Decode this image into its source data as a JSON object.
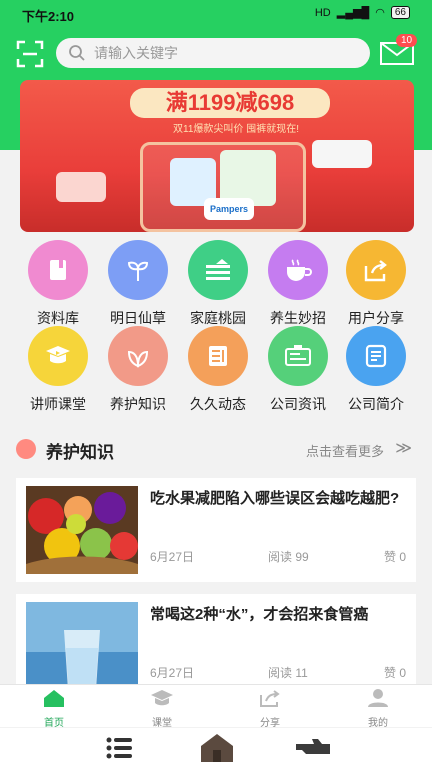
{
  "status": {
    "time": "下午2:10",
    "network": "HD",
    "battery": "66"
  },
  "search": {
    "placeholder": "请输入关键字"
  },
  "mail": {
    "badge": "10"
  },
  "banner": {
    "headline": "满1199减698",
    "subline": "双11爆款尖叫价 囤裤就现在!",
    "brand": "Pampers"
  },
  "grid": [
    {
      "label": "资料库",
      "color": "#f08ad0",
      "icon": "book-icon"
    },
    {
      "label": "明日仙草",
      "color": "#7d9ef5",
      "icon": "sprout-icon"
    },
    {
      "label": "家庭桃园",
      "color": "#3fcf86",
      "icon": "garden-icon"
    },
    {
      "label": "养生妙招",
      "color": "#c57cf0",
      "icon": "tea-cup-icon"
    },
    {
      "label": "用户分享",
      "color": "#f6b733",
      "icon": "share-icon"
    },
    {
      "label": "讲师课堂",
      "color": "#f6d53a",
      "icon": "video-icon"
    },
    {
      "label": "养护知识",
      "color": "#f29a88",
      "icon": "leaf-icon"
    },
    {
      "label": "久久动态",
      "color": "#f4a05a",
      "icon": "news-icon"
    },
    {
      "label": "公司资讯",
      "color": "#55d07a",
      "icon": "card-icon"
    },
    {
      "label": "公司简介",
      "color": "#4aa3f0",
      "icon": "document-icon"
    }
  ],
  "section": {
    "title": "养护知识",
    "more": "点击查看更多",
    "arrow": "≫"
  },
  "articles": [
    {
      "title": "吃水果减肥陷入哪些误区会越吃越肥?",
      "date": "6月27日",
      "views": "阅读 99",
      "likes": "赞 0"
    },
    {
      "title": "常喝这2种“水”，才会招来食管癌",
      "date": "6月27日",
      "views": "阅读 11",
      "likes": "赞 0"
    }
  ],
  "tabs": [
    {
      "label": "首页"
    },
    {
      "label": "课堂"
    },
    {
      "label": "分享"
    },
    {
      "label": "我的"
    }
  ],
  "colors": {
    "brand": "#26d061",
    "active": "#26a85c",
    "badge": "#ff4d4f"
  }
}
